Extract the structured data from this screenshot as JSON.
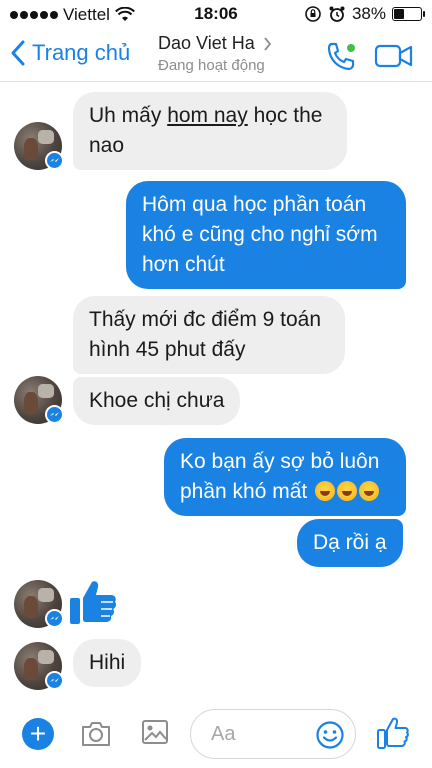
{
  "status_bar": {
    "carrier": "Viettel",
    "time": "18:06",
    "battery": "38%",
    "battery_level": 0.38
  },
  "header": {
    "back_label": "Trang chủ",
    "contact_name": "Dao Viet Ha",
    "contact_status": "Đang hoạt động",
    "chevron_icon": "chevron-right-icon",
    "call_icon": "phone-icon",
    "video_icon": "video-camera-icon"
  },
  "messages": [
    {
      "direction": "incoming",
      "text": "Uh mấy hom nay học the nao",
      "underlined": "hom nay",
      "show_avatar": true
    },
    {
      "direction": "outgoing",
      "text": "Hôm qua học phần toán khó e cũng cho nghỉ sớm hơn chút"
    },
    {
      "direction": "incoming",
      "text": "Thấy mới đc điểm 9 toán hình 45 phut đấy",
      "show_avatar": false
    },
    {
      "direction": "incoming",
      "text": "Khoe chị chưa",
      "show_avatar": true
    },
    {
      "direction": "outgoing",
      "text": "Ko bạn ấy sợ bỏ luôn phần khó mất",
      "emoji": "face-with-tears-of-joy x3"
    },
    {
      "direction": "outgoing",
      "text": "Dạ rồi ạ"
    },
    {
      "direction": "incoming",
      "type": "like-sticker",
      "icon": "thumbs-up-icon",
      "show_avatar": true
    },
    {
      "direction": "incoming",
      "text": "Hihi",
      "show_avatar": true
    }
  ],
  "composer": {
    "placeholder": "Aa",
    "plus_icon": "plus-icon",
    "camera_icon": "camera-icon",
    "image_icon": "image-icon",
    "emoji_icon": "smile-icon",
    "like_icon": "thumbs-up-icon"
  },
  "colors": {
    "accent": "#1a82e2",
    "incoming_bubble": "#eeeeef",
    "outgoing_bubble": "#1a82e2"
  }
}
